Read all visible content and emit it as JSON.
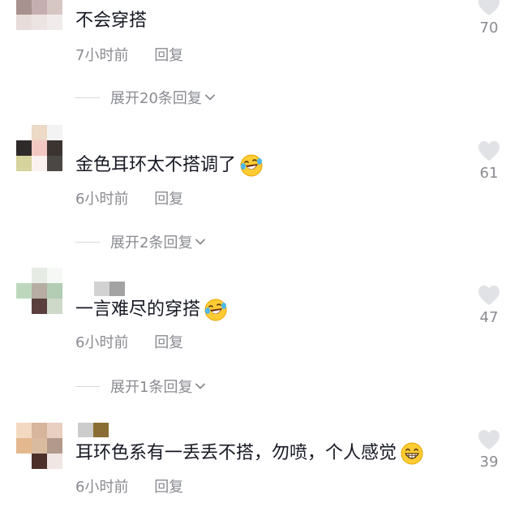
{
  "colors": {
    "text": "#161823",
    "secondary": "#8a8b91",
    "heart": "#e1e2e5",
    "divider": "#d7d8db"
  },
  "comments": [
    {
      "text": "不会穿搭",
      "time": "7小时前",
      "reply_label": "回复",
      "expand_label": "展开20条回复",
      "likes": "70",
      "emoji": null,
      "avatar_colors": [
        "#d9c9c6",
        "#b9a6a4",
        "#c9b5b2",
        "#a89290",
        "#c5aeb0",
        "#d7c7c4",
        "#e7dcda",
        "#ece4e3",
        "#f1eceb"
      ]
    },
    {
      "text": "金色耳环太不搭调了",
      "time": "6小时前",
      "reply_label": "回复",
      "expand_label": "展开2条回复",
      "likes": "61",
      "emoji": "laughing-tears-emoji",
      "avatar_colors": [
        "#ffffff",
        "#ecd9c6",
        "#f3f3f3",
        "#2f2a2a",
        "#f3c8c2",
        "#3b3430",
        "#d6d39c",
        "#fbf1ee",
        "#4a4744"
      ],
      "name_colors": []
    },
    {
      "text": "一言难尽的穿搭",
      "time": "6小时前",
      "reply_label": "回复",
      "expand_label": "展开1条回复",
      "likes": "47",
      "emoji": "laughing-tears-emoji",
      "avatar_colors": [
        "#ffffff",
        "#e6ece4",
        "#f6f8f5",
        "#bdd7bd",
        "#b7ada3",
        "#b2cdb4",
        "#ffffff",
        "#5b3f3f",
        "#cfd9c9"
      ],
      "name_colors": [
        "#d2d2d2",
        "#a3a3a3"
      ]
    },
    {
      "text": "耳环色系有一丢丢不搭，勿喷，个人感觉",
      "time": "6小时前",
      "reply_label": "回复",
      "expand_label": "",
      "likes": "39",
      "emoji": "grinning-emoji",
      "avatar_colors": [
        "#f3d9c2",
        "#d7b49c",
        "#e8cfc2",
        "#e4b88e",
        "#d9bba0",
        "#b3998c",
        "#ffffff",
        "#4d2f2a",
        "#f0e6e3"
      ],
      "name_colors": [
        "#cccccc",
        "#8a6d34"
      ]
    }
  ]
}
